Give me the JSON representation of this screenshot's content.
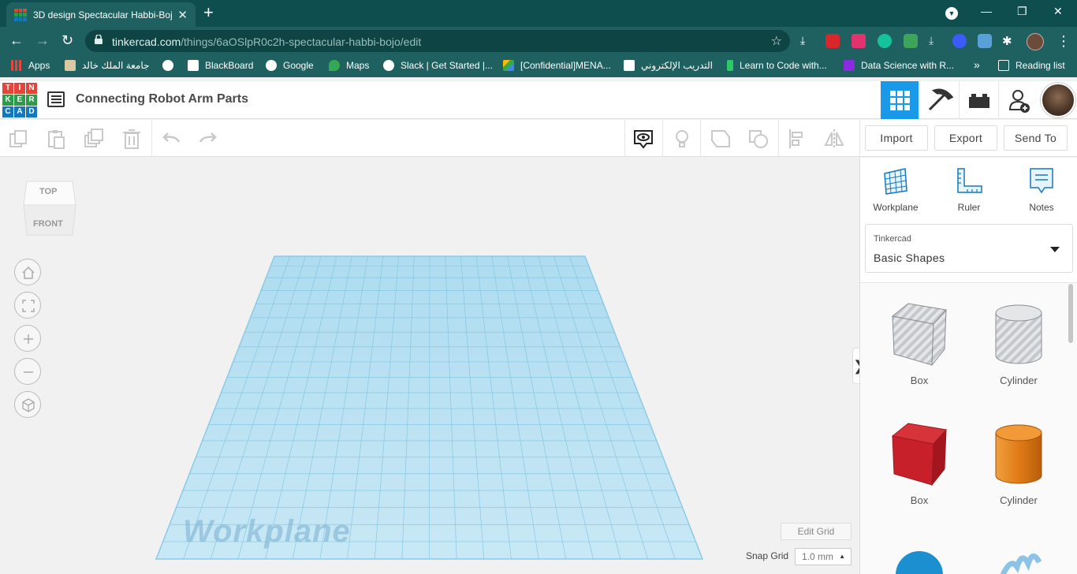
{
  "browser": {
    "tab_title": "3D design Spectacular Habbi-Boj",
    "tab_close": "✕",
    "new_tab": "+",
    "url_host": "tinkercad.com",
    "url_path": "/things/6aOSlpR0c2h-spectacular-habbi-bojo/edit",
    "window_controls": [
      "—",
      "❐",
      "✕"
    ]
  },
  "bookmarks": {
    "items": [
      {
        "label": "Apps",
        "color": "#e8453c"
      },
      {
        "label": "جامعة الملك خالد",
        "color": "#d9c9a3"
      },
      {
        "label": "",
        "color": "#ffffff"
      },
      {
        "label": "BlackBoard",
        "color": "#ffffff"
      },
      {
        "label": "Google",
        "color": "#ffffff"
      },
      {
        "label": "Maps",
        "color": "#34a853"
      },
      {
        "label": "Slack | Get Started |...",
        "color": "#ffffff"
      },
      {
        "label": "[Confidential]MENA...",
        "color": "#fbbc04"
      },
      {
        "label": "التدريب الإلكتروني",
        "color": "#ffffff"
      },
      {
        "label": "Learn to Code with...",
        "color": "#2ec866"
      },
      {
        "label": "Data Science with R...",
        "color": "#8a2be2"
      }
    ],
    "more": "»",
    "reading_list": "Reading list"
  },
  "app": {
    "logo_letters": [
      "T",
      "I",
      "N",
      "K",
      "E",
      "R",
      "C",
      "A",
      "D"
    ],
    "logo_colors": [
      "#e2463b",
      "#e2463b",
      "#e2463b",
      "#2a9d4b",
      "#2a9d4b",
      "#2a9d4b",
      "#1478be",
      "#1478be",
      "#1478be"
    ],
    "design_title": "Connecting Robot Arm Parts"
  },
  "toolbar": {
    "import": "Import",
    "export": "Export",
    "send_to": "Send To"
  },
  "workspace": {
    "viewcube_top": "TOP",
    "viewcube_front": "FRONT",
    "workplane_label": "Workplane",
    "edit_grid": "Edit Grid",
    "snap_grid_label": "Snap Grid",
    "snap_grid_value": "1.0 mm",
    "snap_caret": "▲",
    "collapse_glyph": "❯"
  },
  "right_panel": {
    "tools": [
      "Workplane",
      "Ruler",
      "Notes"
    ],
    "library_source": "Tinkercad",
    "library_name": "Basic Shapes",
    "shapes": [
      {
        "label": "Box",
        "style": "hole"
      },
      {
        "label": "Cylinder",
        "style": "hole"
      },
      {
        "label": "Box",
        "color": "#c8202a"
      },
      {
        "label": "Cylinder",
        "color": "#e07b17"
      }
    ]
  }
}
